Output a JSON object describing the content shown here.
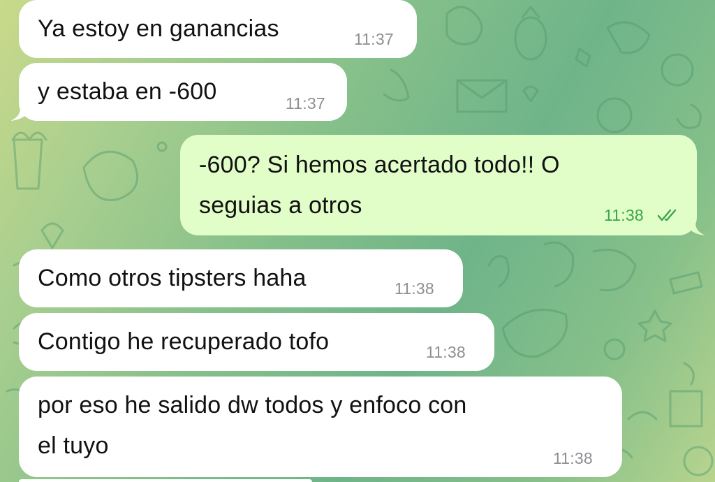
{
  "chat": {
    "messages": [
      {
        "direction": "incoming",
        "text": "Ya estoy en ganancias",
        "time": "11:37"
      },
      {
        "direction": "incoming",
        "text": "y estaba en -600",
        "time": "11:37"
      },
      {
        "direction": "outgoing",
        "lines": [
          "-600? Si hemos acertado todo!! O",
          "seguias a otros"
        ],
        "time": "11:38",
        "status": "read-double-check-icon"
      },
      {
        "direction": "incoming",
        "text": "Como otros tipsters haha",
        "time": "11:38"
      },
      {
        "direction": "incoming",
        "text": "Contigo he recuperado tofo",
        "time": "11:38"
      },
      {
        "direction": "incoming",
        "lines": [
          "por eso he salido dw todos y enfoco con",
          "el tuyo"
        ],
        "time": "11:38"
      }
    ]
  },
  "colors": {
    "incoming_bubble": "#ffffff",
    "outgoing_bubble": "#e1fdc8",
    "outgoing_time": "#3aa64a",
    "incoming_time": "#8e8e93"
  }
}
